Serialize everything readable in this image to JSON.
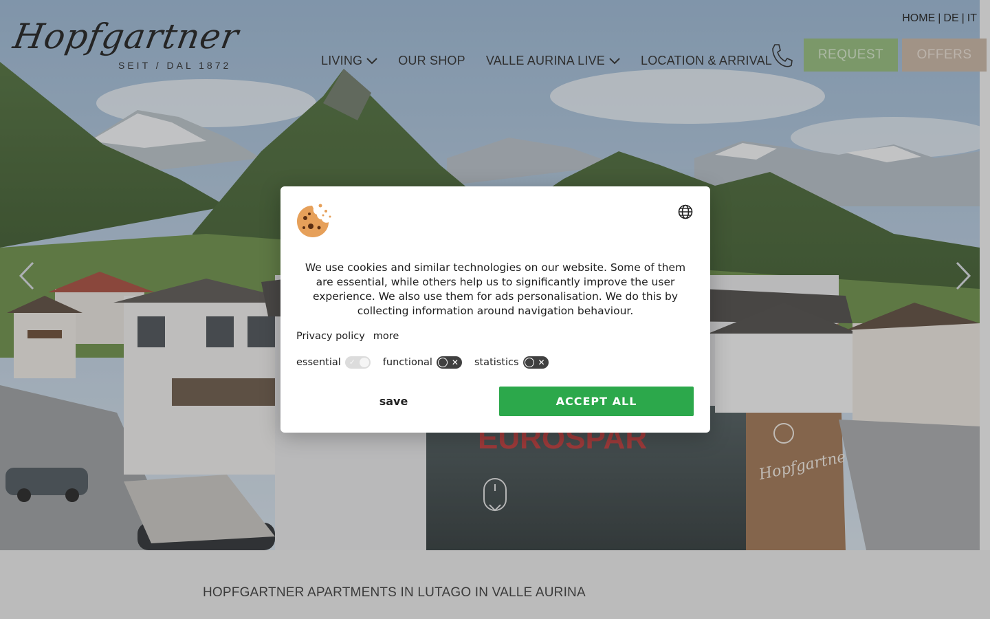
{
  "header": {
    "logo": {
      "script": "Hopfgartner",
      "subtitle": "SEIT / DAL 1872"
    },
    "languages": [
      "HOME",
      "DE",
      "IT"
    ],
    "nav": [
      {
        "label": "LIVING",
        "has_dropdown": true
      },
      {
        "label": "OUR SHOP",
        "has_dropdown": false
      },
      {
        "label": "VALLE AURINA LIVE",
        "has_dropdown": true
      },
      {
        "label": "LOCATION & ARRIVAL",
        "has_dropdown": false
      }
    ],
    "request_label": "REQUEST",
    "offers_label": "OFFERS",
    "icons": {
      "phone": "phone-icon",
      "prev": "chevron-left-icon",
      "next": "chevron-right-icon",
      "scroll": "mouse-scroll-icon"
    }
  },
  "hero": {
    "storefront_sign": "EUROSPAR",
    "building_logo": "Hopfgartner"
  },
  "section": {
    "title": "HOPFGARTNER APARTMENTS IN LUTAGO IN VALLE AURINA"
  },
  "cookie_banner": {
    "icons": {
      "cookie": "cookie-icon",
      "language": "globe-icon"
    },
    "text": "We use cookies and similar technologies on our website. Some of them are essential, while others help us to significantly improve the user experience. We also use them for ads personalisation. We do this by collecting information around navigation behaviour.",
    "links": {
      "privacy": "Privacy policy",
      "more": "more"
    },
    "toggles": [
      {
        "label": "essential",
        "state": "on-locked"
      },
      {
        "label": "functional",
        "state": "off"
      },
      {
        "label": "statistics",
        "state": "off"
      }
    ],
    "save_label": "save",
    "accept_label": "ACCEPT ALL"
  },
  "colors": {
    "accept": "#2ca84b",
    "request": "#93bc7b",
    "offers": "#c8b5a2"
  }
}
